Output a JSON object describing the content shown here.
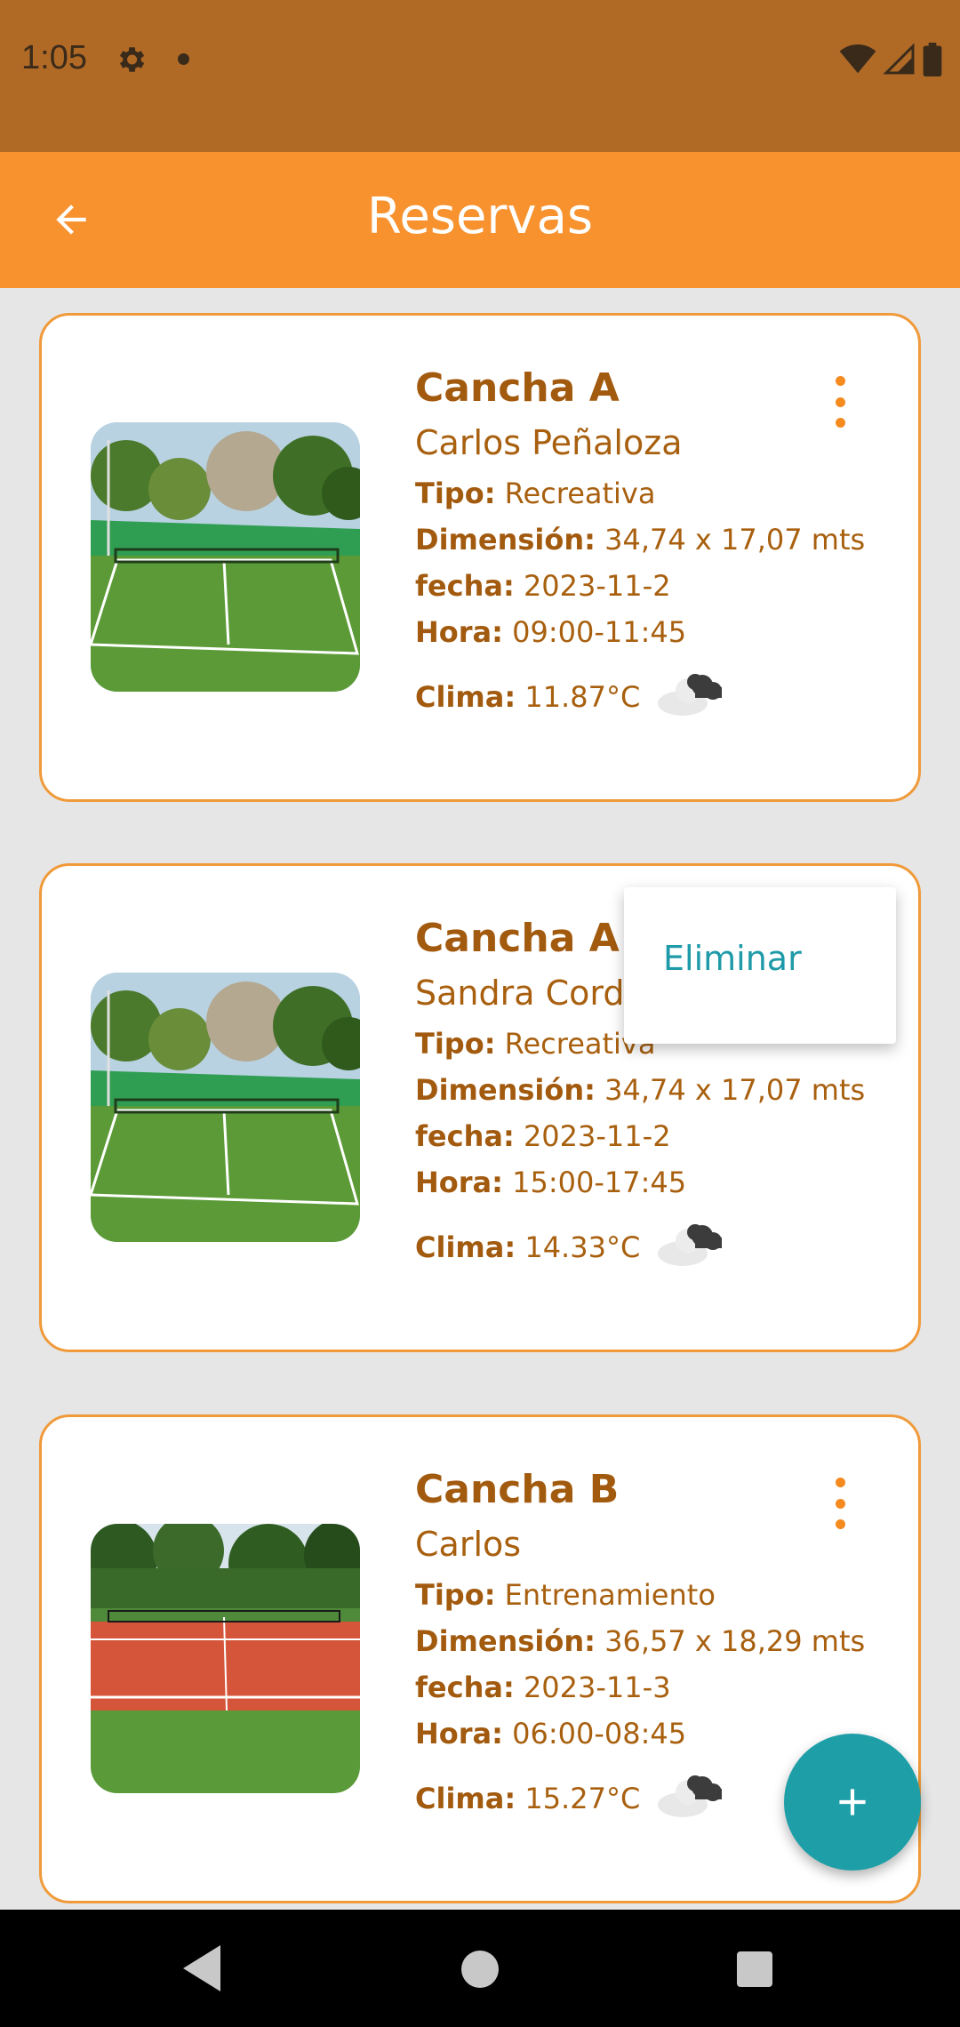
{
  "status": {
    "time": "1:05",
    "icons": [
      "settings-icon",
      "notification-dot",
      "wifi-icon",
      "signal-icon",
      "battery-icon"
    ]
  },
  "app_bar": {
    "title": "Reservas",
    "back_icon": "arrow-left-icon"
  },
  "colors": {
    "status_bar": "#b06a26",
    "app_bar": "#f7922f",
    "card_border": "#f09a3a",
    "text_brown": "#a8600f",
    "accent_teal": "#1e9fa8"
  },
  "reservations": [
    {
      "title": "Cancha A",
      "user": "Carlos Peñaloza",
      "tipo_label": "Tipo:",
      "tipo": "Recreativa",
      "dimension_label": "Dimensión:",
      "dimension": "34,74 x 17,07 mts",
      "fecha_label": "fecha:",
      "fecha": "2023-11-2",
      "hora_label": "Hora:",
      "hora": "09:00-11:45",
      "clima_label": "Clima:",
      "clima": "11.87°C",
      "weather_icon": "cloudy-icon",
      "court": "green"
    },
    {
      "title": "Cancha A",
      "user": "Sandra Cord",
      "tipo_label": "Tipo:",
      "tipo": "Recreativa",
      "dimension_label": "Dimensión:",
      "dimension": "34,74 x 17,07 mts",
      "fecha_label": "fecha:",
      "fecha": "2023-11-2",
      "hora_label": "Hora:",
      "hora": "15:00-17:45",
      "clima_label": "Clima:",
      "clima": "14.33°C",
      "weather_icon": "cloudy-icon",
      "court": "green"
    },
    {
      "title": "Cancha B",
      "user": "Carlos",
      "tipo_label": "Tipo:",
      "tipo": "Entrenamiento",
      "dimension_label": "Dimensión:",
      "dimension": "36,57 x 18,29 mts",
      "fecha_label": "fecha:",
      "fecha": "2023-11-3",
      "hora_label": "Hora:",
      "hora": "06:00-08:45",
      "clima_label": "Clima:",
      "clima": "15.27°C",
      "weather_icon": "cloudy-icon",
      "court": "clay"
    }
  ],
  "popup_menu": {
    "item": "Eliminar"
  },
  "fab": {
    "icon": "plus-icon"
  }
}
